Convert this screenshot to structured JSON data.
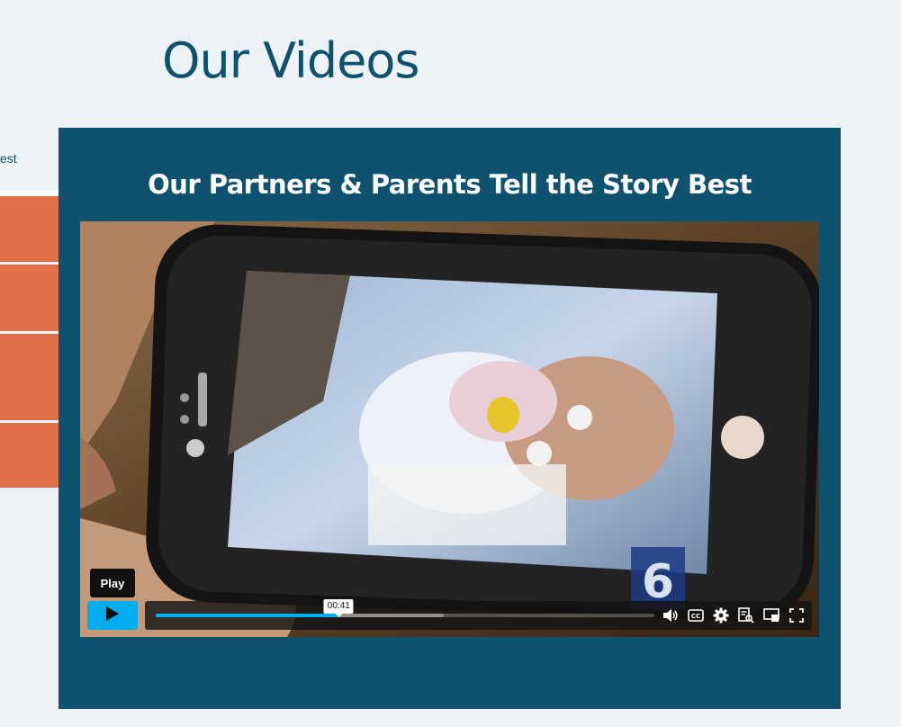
{
  "page": {
    "title": "Our Videos"
  },
  "side_tab": {
    "label": "est"
  },
  "section": {
    "heading": "Our Partners & Parents Tell the Story Best"
  },
  "player": {
    "tooltip": "Play",
    "current_time": "00:41",
    "played_fraction": 0.367,
    "buffered_fraction": 0.578,
    "controls": [
      "volume-icon",
      "closed-captions-icon",
      "settings-icon",
      "transcript-icon",
      "picture-in-picture-icon",
      "fullscreen-icon"
    ],
    "accent_color": "#00adef"
  },
  "colors": {
    "panel": "#0f5270",
    "accent_orange": "#e07048",
    "background": "#edf2f7"
  }
}
